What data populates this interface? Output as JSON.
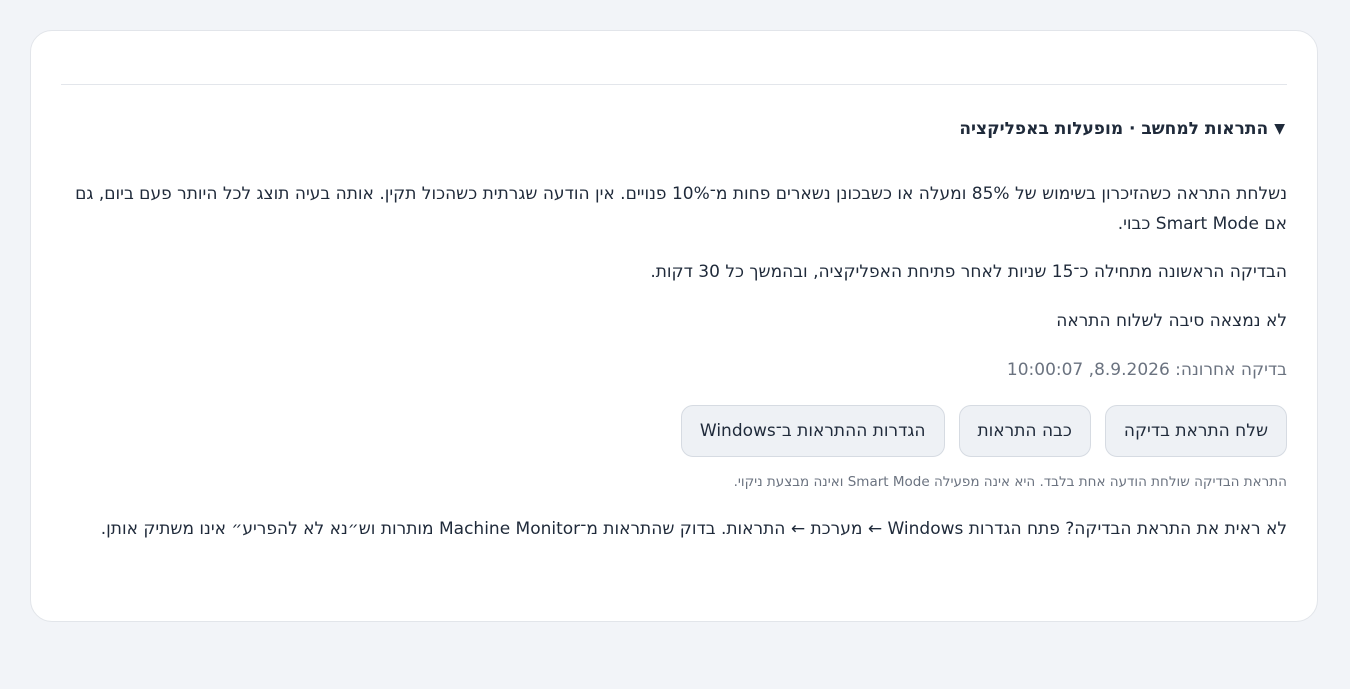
{
  "panel": {
    "summary_icon": "triangle-down-icon",
    "summary_triangle": "▼",
    "summary_title": "התראות למחשב · מופעלות באפליקציה",
    "description": "נשלחת התראה כשהזיכרון בשימוש של 85% ומעלה או כשבכונן נשארים פחות מ־10% פנויים. אין הודעה שגרתית כשהכול תקין. אותה בעיה תוצג לכל היותר פעם ביום, גם אם Smart Mode כבוי.",
    "schedule": "הבדיקה הראשונה מתחילה כ־15 שניות לאחר פתיחת האפליקציה, ובהמשך כל 30 דקות.",
    "status": "לא נמצאה סיבה לשלוח התראה",
    "last_check": "בדיקה אחרונה: 8.9.2026, 10:00:07",
    "buttons": {
      "send_test": "שלח התראת בדיקה",
      "disable": "כבה התראות",
      "windows_settings": "הגדרות ההתראות ב־Windows"
    },
    "test_note": "התראת הבדיקה שולחת הודעה אחת בלבד. היא אינה מפעילה Smart Mode ואינה מבצעת ניקוי.",
    "help_text": "לא ראית את התראת הבדיקה? פתח הגדרות Windows ← מערכת ← התראות. בדוק שהתראות מ־Machine Monitor מותרות וש״נא לא להפריע״ אינו משתיק אותן."
  }
}
